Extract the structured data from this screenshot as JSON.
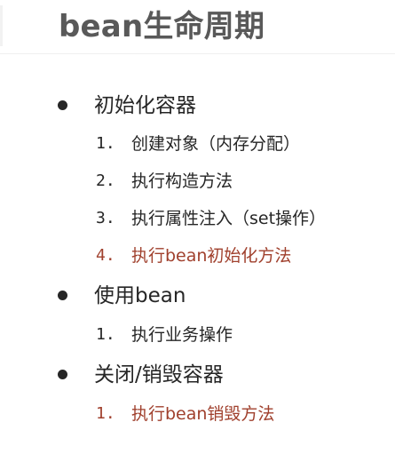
{
  "title": "bean生命周期",
  "colors": {
    "title": "#595959",
    "text": "#262626",
    "highlight": "#a0402d"
  },
  "sections": [
    {
      "label": "初始化容器",
      "items": [
        {
          "num": "1.",
          "text": "创建对象（内存分配）"
        },
        {
          "num": "2.",
          "text": "执行构造方法"
        },
        {
          "num": "3.",
          "text": "执行属性注入（set操作）"
        },
        {
          "num": "4.",
          "text": "执行bean初始化方法",
          "highlight": true
        }
      ]
    },
    {
      "label": "使用bean",
      "items": [
        {
          "num": "1.",
          "text": "执行业务操作"
        }
      ]
    },
    {
      "label": "关闭/销毁容器",
      "items": [
        {
          "num": "1.",
          "text": "执行bean销毁方法",
          "highlight": true
        }
      ]
    }
  ]
}
